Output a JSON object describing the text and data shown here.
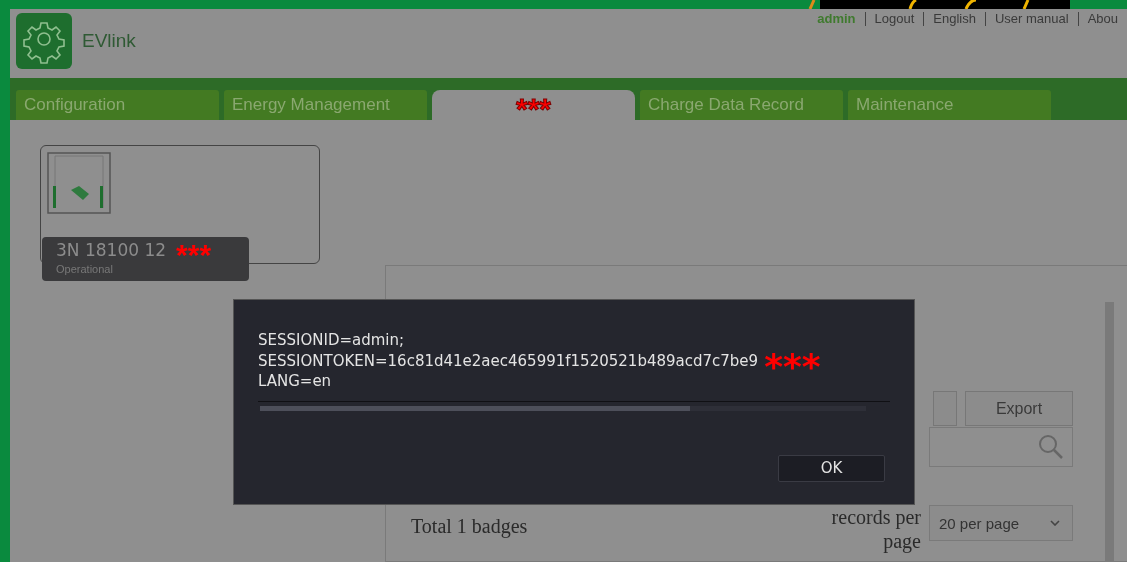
{
  "header": {
    "logo_text": "EVlink",
    "links": [
      {
        "label": "admin",
        "kind": "user"
      },
      {
        "label": "Logout",
        "kind": "link"
      },
      {
        "label": "English",
        "kind": "link"
      },
      {
        "label": "User manual",
        "kind": "link"
      },
      {
        "label": "Abou",
        "kind": "link"
      }
    ]
  },
  "tabs": [
    {
      "label": "Configuration",
      "selected": false
    },
    {
      "label": "Energy Management",
      "selected": false
    },
    {
      "label": "***",
      "selected": true
    },
    {
      "label": "Charge Data Record",
      "selected": false
    },
    {
      "label": "Maintenance",
      "selected": false
    }
  ],
  "station": {
    "name": "3N 18100 12",
    "redaction": "***",
    "status": "Operational"
  },
  "panel": {
    "buttons": [
      "Export"
    ],
    "total": "Total 1 badges",
    "records_label": "records per page",
    "page_size": "20 per page"
  },
  "dialog": {
    "lines": [
      "SESSIONID=admin;",
      "SESSIONTOKEN=16c81d41e2aec465991f1520521b489acd7c7be9",
      "LANG=en"
    ],
    "redaction": "***",
    "progress": {
      "level": 0.71
    },
    "button": "OK"
  }
}
